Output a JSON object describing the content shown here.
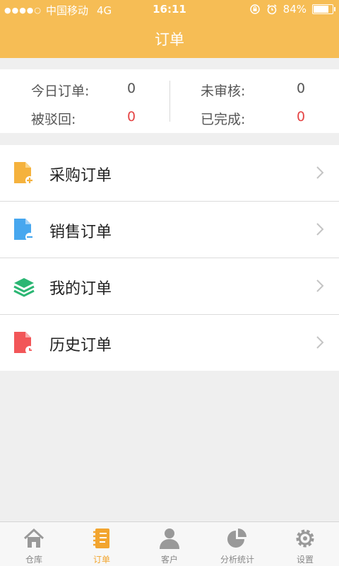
{
  "status_bar": {
    "carrier": "中国移动",
    "network": "4G",
    "time": "16:11",
    "battery": "84%",
    "battery_level": 0.84
  },
  "header": {
    "title": "订单"
  },
  "stats": {
    "today_label": "今日订单:",
    "today_value": "0",
    "pending_label": "未审核:",
    "pending_value": "0",
    "rejected_label": "被驳回:",
    "rejected_value": "0",
    "done_label": "已完成:",
    "done_value": "0"
  },
  "menu": [
    {
      "label": "采购订单",
      "icon": "purchase-order-icon",
      "color": "#f5b23d"
    },
    {
      "label": "销售订单",
      "icon": "sales-order-icon",
      "color": "#47a7ef"
    },
    {
      "label": "我的订单",
      "icon": "layers-icon",
      "color": "#2bb673"
    },
    {
      "label": "历史订单",
      "icon": "history-order-icon",
      "color": "#f25658"
    }
  ],
  "tabs": [
    {
      "label": "仓库",
      "icon": "home-icon"
    },
    {
      "label": "订单",
      "icon": "notebook-icon",
      "active": true
    },
    {
      "label": "客户",
      "icon": "user-icon"
    },
    {
      "label": "分析统计",
      "icon": "pie-chart-icon"
    },
    {
      "label": "设置",
      "icon": "gear-icon"
    }
  ],
  "colors": {
    "accent": "#f6bd55",
    "alert_value": "#e54545",
    "tab_active": "#f2a52f"
  }
}
